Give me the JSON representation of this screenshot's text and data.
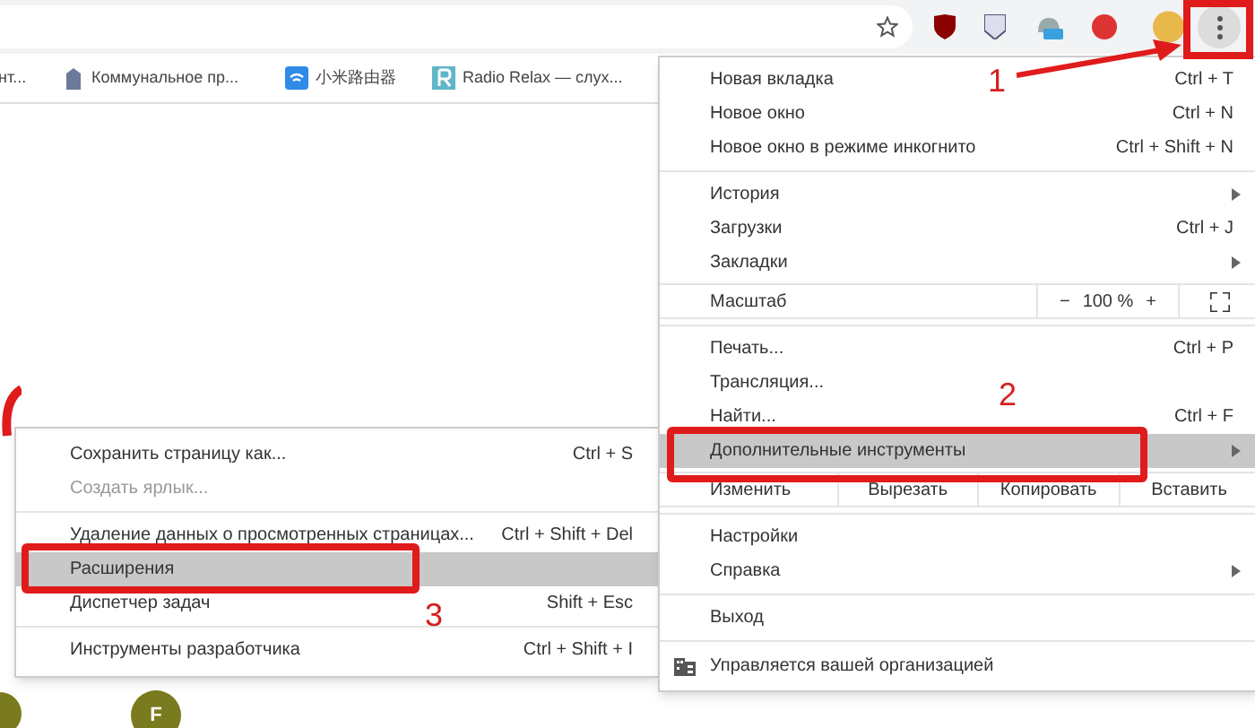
{
  "bookmarks": [
    {
      "label": "нт..."
    },
    {
      "label": "Коммунальное пр..."
    },
    {
      "label": "小米路由器"
    },
    {
      "label": "Radio Relax — слух..."
    }
  ],
  "menu": {
    "sections": [
      [
        {
          "kind": "item",
          "label": "Новая вкладка",
          "shortcut": "Ctrl + T",
          "submenu": false,
          "highlighted": false
        },
        {
          "kind": "item",
          "label": "Новое окно",
          "shortcut": "Ctrl + N",
          "submenu": false,
          "highlighted": false
        },
        {
          "kind": "item",
          "label": "Новое окно в режиме инкогнито",
          "shortcut": "Ctrl + Shift + N",
          "submenu": false,
          "highlighted": false
        }
      ],
      [
        {
          "kind": "item",
          "label": "История",
          "submenu": true,
          "highlighted": false
        },
        {
          "kind": "item",
          "label": "Загрузки",
          "shortcut": "Ctrl + J",
          "submenu": false,
          "highlighted": false
        },
        {
          "kind": "item",
          "label": "Закладки",
          "submenu": true,
          "highlighted": false
        }
      ],
      [
        {
          "kind": "zoom",
          "label": "Масштаб",
          "minus": "−",
          "value": "100 %",
          "plus": "+"
        }
      ],
      [
        {
          "kind": "item",
          "label": "Печать...",
          "shortcut": "Ctrl + P",
          "submenu": false,
          "highlighted": false
        },
        {
          "kind": "item",
          "label": "Трансляция...",
          "submenu": false,
          "highlighted": false
        },
        {
          "kind": "item",
          "label": "Найти...",
          "shortcut": "Ctrl + F",
          "submenu": false,
          "highlighted": false
        },
        {
          "kind": "item",
          "label": "Дополнительные инструменты",
          "submenu": true,
          "highlighted": true
        }
      ],
      [
        {
          "kind": "edit",
          "label": "Изменить",
          "buttons": [
            "Вырезать",
            "Копировать",
            "Вставить"
          ]
        }
      ],
      [
        {
          "kind": "item",
          "label": "Настройки",
          "submenu": false,
          "highlighted": false
        },
        {
          "kind": "item",
          "label": "Справка",
          "submenu": true,
          "highlighted": false
        }
      ],
      [
        {
          "kind": "item",
          "label": "Выход",
          "submenu": false,
          "highlighted": false
        }
      ],
      [
        {
          "kind": "managed",
          "label": "Управляется вашей организацией"
        }
      ]
    ]
  },
  "submenu": {
    "sections": [
      [
        {
          "label": "Сохранить страницу как...",
          "shortcut": "Ctrl + S",
          "disabled": false,
          "highlighted": false
        },
        {
          "label": "Создать ярлык...",
          "disabled": true,
          "highlighted": false
        }
      ],
      [
        {
          "label": "Удаление данных о просмотренных страницах...",
          "shortcut": "Ctrl + Shift + Del",
          "disabled": false,
          "highlighted": false
        },
        {
          "label": "Расширения",
          "disabled": false,
          "highlighted": true
        },
        {
          "label": "Диспетчер задач",
          "shortcut": "Shift + Esc",
          "disabled": false,
          "highlighted": false
        }
      ],
      [
        {
          "label": "Инструменты разработчика",
          "shortcut": "Ctrl + Shift + I",
          "disabled": false,
          "highlighted": false
        }
      ]
    ]
  },
  "annotations": [
    {
      "number": "1"
    },
    {
      "number": "2"
    },
    {
      "number": "3"
    }
  ],
  "avatar": {
    "initial": "F"
  }
}
